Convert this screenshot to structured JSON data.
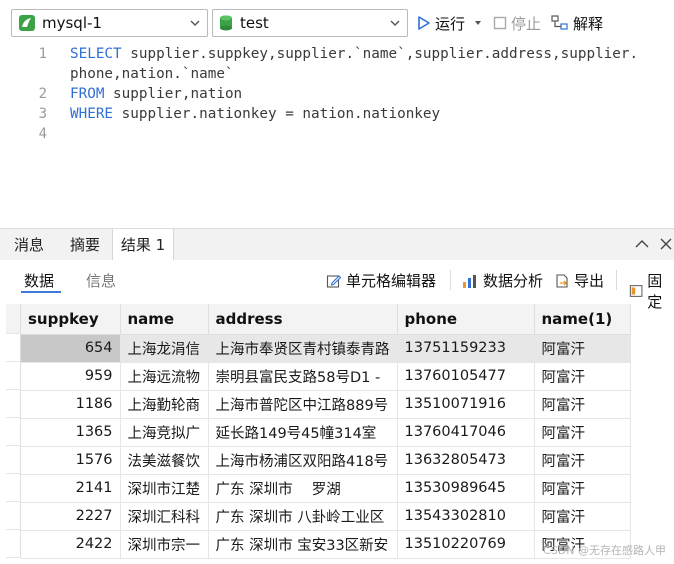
{
  "toolbar": {
    "connection": "mysql-1",
    "database": "test",
    "run_label": "运行",
    "stop_label": "停止",
    "explain_label": "解释"
  },
  "editor": {
    "line_numbers": [
      "1",
      "2",
      "3",
      "4"
    ],
    "line1a_kw": "SELECT",
    "line1a_rest": " supplier.suppkey,supplier.`name`,supplier.address,supplier.",
    "line1b": "phone,nation.`name`",
    "line2_kw": "FROM",
    "line2_rest": " supplier,nation",
    "line3_kw": "WHERE",
    "line3_rest": " supplier.nationkey = nation.nationkey"
  },
  "result_tabs": [
    "消息",
    "摘要",
    "结果 1"
  ],
  "subbar": {
    "tab_data": "数据",
    "tab_info": "信息",
    "cell_editor": "单元格编辑器",
    "data_analysis": "数据分析",
    "export": "导出",
    "pin": "固定"
  },
  "grid": {
    "columns": [
      "suppkey",
      "name",
      "address",
      "phone",
      "name(1)"
    ],
    "rows": [
      [
        "654",
        "上海龙涓信",
        "上海市奉贤区青村镇泰青路",
        "13751159233",
        "阿富汗"
      ],
      [
        "959",
        "上海远流物",
        "崇明县富民支路58号D1 -",
        "13760105477",
        "阿富汗"
      ],
      [
        "1186",
        "上海勤轮商",
        "上海市普陀区中江路889号",
        "13510071916",
        "阿富汗"
      ],
      [
        "1365",
        "上海竞拟广",
        "延长路149号45幢314室",
        "13760417046",
        "阿富汗"
      ],
      [
        "1576",
        "法美滋餐饮",
        "上海市杨浦区双阳路418号",
        "13632805473",
        "阿富汗"
      ],
      [
        "2141",
        "深圳市江楚",
        "广东 深圳市　 罗湖",
        "13530989645",
        "阿富汗"
      ],
      [
        "2227",
        "深圳汇科科",
        "广东 深圳市 八卦岭工业区",
        "13543302810",
        "阿富汗"
      ],
      [
        "2422",
        "深圳市宗一",
        "广东 深圳市 宝安33区新安",
        "13510220769",
        "阿富汗"
      ]
    ]
  },
  "watermark": "CSDN @无存在感路人甲",
  "colors": {
    "keyword": "#2f6fd6",
    "accent": "#3f7bd6"
  }
}
